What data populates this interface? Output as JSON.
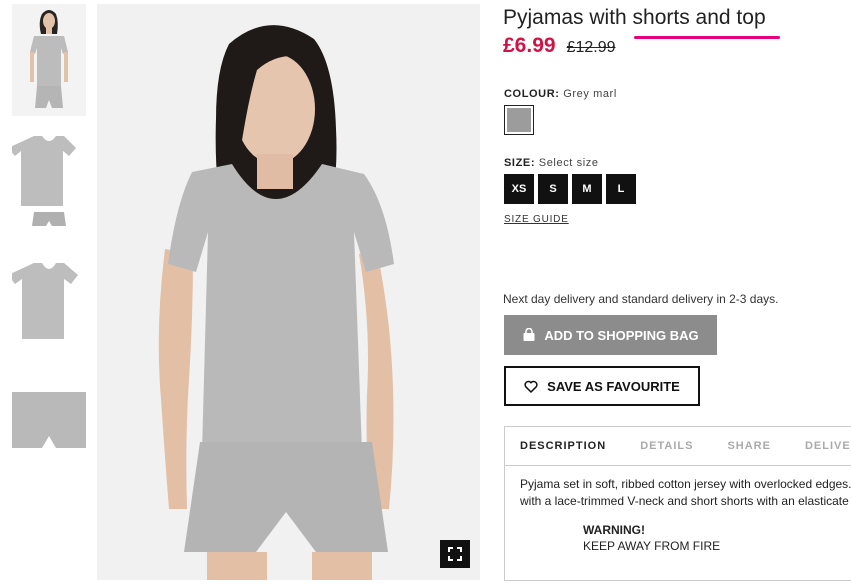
{
  "product": {
    "title": "Pyjamas with shorts and top",
    "price_sale": "£6.99",
    "price_old": "£12.99"
  },
  "colour": {
    "label": "COLOUR:",
    "value": "Grey marl",
    "swatch_color": "#9c9c9c"
  },
  "size": {
    "label": "SIZE:",
    "value": "Select size",
    "options": [
      "XS",
      "S",
      "M",
      "L"
    ],
    "guide_link": "SIZE GUIDE"
  },
  "delivery_text": "Next day delivery and standard delivery in 2-3 days.",
  "buttons": {
    "add_to_bag": "ADD TO SHOPPING BAG",
    "save_favourite": "SAVE AS FAVOURITE"
  },
  "tabs": [
    "DESCRIPTION",
    "DETAILS",
    "SHARE",
    "DELIVERY"
  ],
  "description": {
    "line1": "Pyjama set in soft, ribbed cotton jersey with overlocked edges.",
    "line2": "with a lace-trimmed V-neck and short shorts with an elasticate",
    "warning_title": "WARNING!",
    "warning_text": "KEEP AWAY FROM FIRE"
  },
  "colors": {
    "sale_price": "#d01345",
    "accent_underline": "#e6007e",
    "garment_grey": "#b9b9b9",
    "size_button_bg": "#111111",
    "add_bag_bg": "#8c8c8c"
  },
  "icons": {
    "bag": "shopping-bag-icon",
    "heart": "heart-icon",
    "zoom": "fullscreen-icon"
  }
}
